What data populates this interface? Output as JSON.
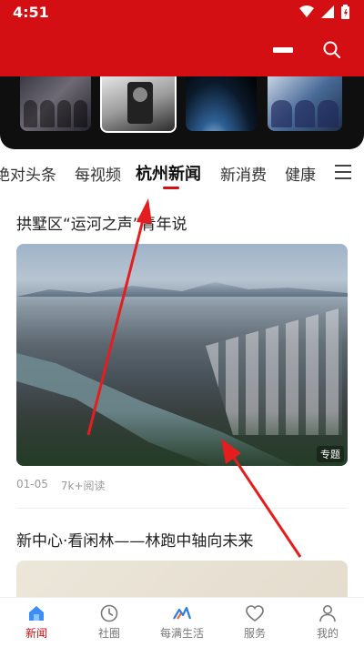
{
  "status_bar": {
    "time": "4:51"
  },
  "tabs": [
    {
      "label": "绝对头条"
    },
    {
      "label": "每视频"
    },
    {
      "label": "杭州新闻",
      "active": true
    },
    {
      "label": "新消费"
    },
    {
      "label": "健康"
    }
  ],
  "articles": [
    {
      "title": "拱墅区“运河之声”青年说",
      "badge": "专题",
      "date": "01-05",
      "reads": "7k+阅读"
    },
    {
      "title": "新中心·看闲林——林跑中轴向未来"
    }
  ],
  "bottom_nav": [
    {
      "label": "新闻",
      "icon": "home-icon",
      "active": true
    },
    {
      "label": "社圈",
      "icon": "clock-icon"
    },
    {
      "label": "每满生活",
      "icon": "life-logo-icon"
    },
    {
      "label": "服务",
      "icon": "heart-icon"
    },
    {
      "label": "我的",
      "icon": "person-icon"
    }
  ],
  "colors": {
    "brand_red": "#d40f14",
    "annotation_red": "#e41e1e"
  }
}
